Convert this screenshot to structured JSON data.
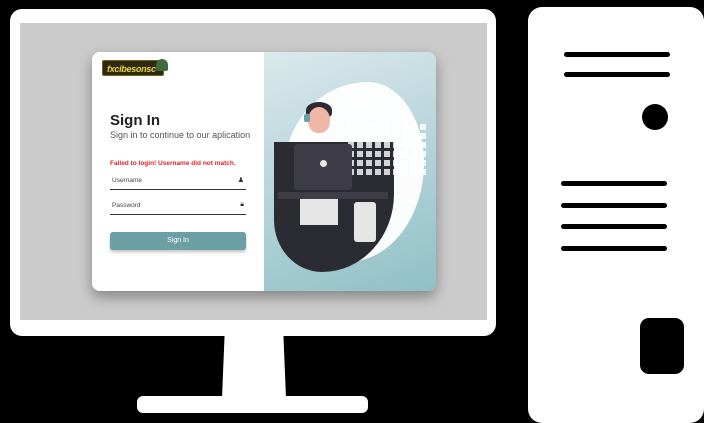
{
  "login": {
    "logo_text": "fxcibesonsc",
    "title": "Sign In",
    "subtitle": "Sign in to continue to our aplication",
    "error": "Failed to login! Username did not match.",
    "username_placeholder": "Username",
    "password_placeholder": "Password",
    "submit_label": "Sign In"
  },
  "icons": {
    "username_field": "person-icon",
    "password_field": "lock-icon"
  },
  "colors": {
    "accent": "#6a9fa3",
    "error": "#e02020",
    "background": "#000000"
  }
}
